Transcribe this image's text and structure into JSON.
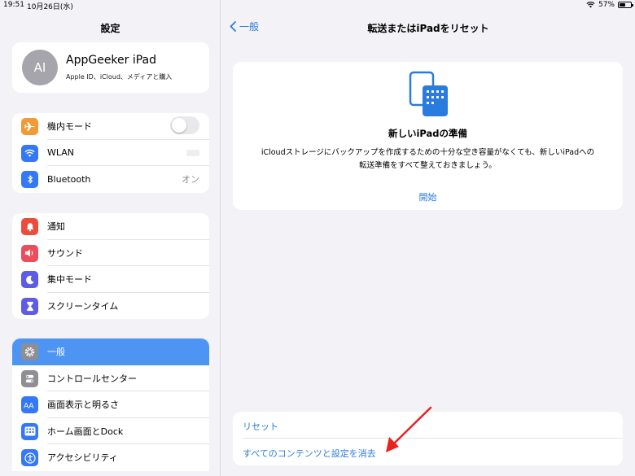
{
  "status": {
    "time": "19:51",
    "date": "10月26日(水)",
    "battery": "57%",
    "battery_level": 0.57
  },
  "sidebar": {
    "title": "設定",
    "profile": {
      "initials": "AI",
      "name": "AppGeeker iPad",
      "subtitle": "Apple ID、iCloud、メディアと購入"
    },
    "group1": [
      {
        "label": "機内モード",
        "icon": "airplane-icon",
        "color": "#f19a38"
      },
      {
        "label": "WLAN",
        "icon": "wifi-icon",
        "color": "#3478f6"
      },
      {
        "label": "Bluetooth",
        "icon": "bluetooth-icon",
        "color": "#3478f6",
        "value": "オン"
      }
    ],
    "group2": [
      {
        "label": "通知",
        "icon": "bell-icon",
        "color": "#eb4d3d"
      },
      {
        "label": "サウンド",
        "icon": "speaker-icon",
        "color": "#eb4d5a"
      },
      {
        "label": "集中モード",
        "icon": "moon-icon",
        "color": "#5e5ce6"
      },
      {
        "label": "スクリーンタイム",
        "icon": "hourglass-icon",
        "color": "#5e5ce6"
      }
    ],
    "group3": [
      {
        "label": "一般",
        "icon": "gear-icon",
        "color": "#8e8e93"
      },
      {
        "label": "コントロールセンター",
        "icon": "switches-icon",
        "color": "#8e8e93"
      },
      {
        "label": "画面表示と明るさ",
        "icon": "text-size-icon",
        "color": "#3478f6"
      },
      {
        "label": "ホーム画面とDock",
        "icon": "grid-icon",
        "color": "#3478f6"
      },
      {
        "label": "アクセシビリティ",
        "icon": "accessibility-icon",
        "color": "#3478f6"
      }
    ]
  },
  "main": {
    "back_label": "一般",
    "title": "転送またはiPadをリセット",
    "card": {
      "icon": "ipads-icon",
      "title": "新しいiPadの準備",
      "desc_line1": "iCloudストレージにバックアップを作成するための十分な空き容量がなくても、新しいiPadへの",
      "desc_line2": "転送準備をすべて整えておきましょう。",
      "link": "開始"
    },
    "bottom": {
      "reset": "リセット",
      "erase": "すべてのコンテンツと設定を消去"
    }
  },
  "colors": {
    "accent": "#2a7bde",
    "selected": "#4e95f3",
    "background": "#f2f2f7",
    "arrow": "#e8231f"
  }
}
